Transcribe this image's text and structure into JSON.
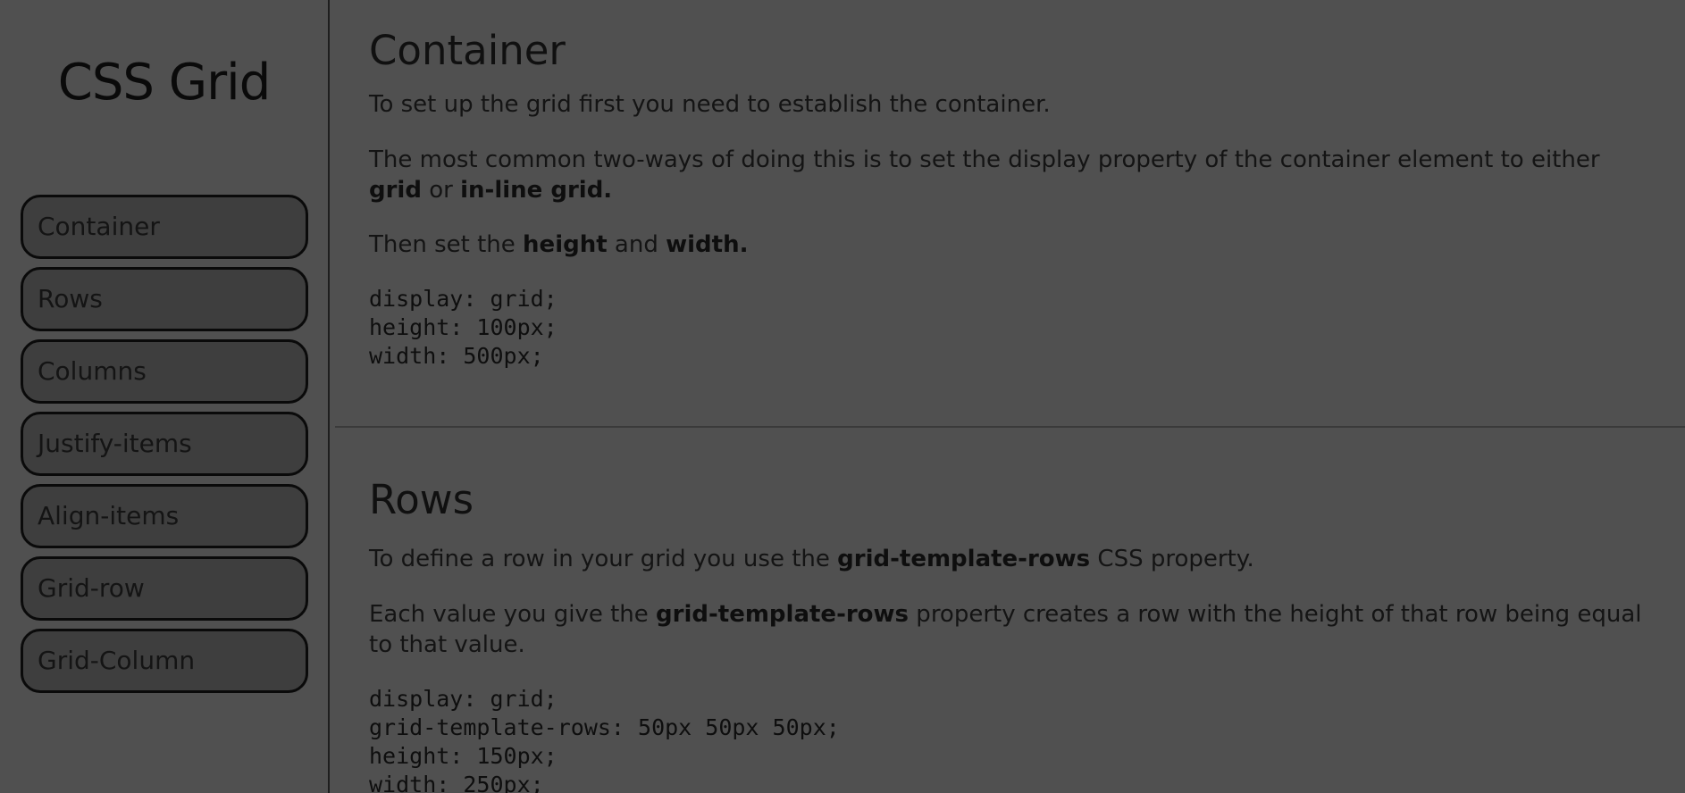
{
  "sidebar": {
    "title": "CSS Grid",
    "items": [
      {
        "label": "Container"
      },
      {
        "label": "Rows"
      },
      {
        "label": "Columns"
      },
      {
        "label": "Justify-items"
      },
      {
        "label": "Align-items"
      },
      {
        "label": "Grid-row"
      },
      {
        "label": "Grid-Column"
      }
    ]
  },
  "sections": {
    "container": {
      "title": "Container",
      "p1": "To set up the grid first you need to establish the container.",
      "p2_a": "The most common two-ways of doing this is to set the display property of the container element to either ",
      "p2_b": "grid",
      "p2_c": " or ",
      "p2_d": "in-line grid.",
      "p3_a": "Then set the ",
      "p3_b": "height",
      "p3_c": " and ",
      "p3_d": "width.",
      "code": [
        "display: grid;",
        "height: 100px;",
        "width: 500px;"
      ]
    },
    "rows": {
      "title": "Rows",
      "p1_a": "To define a row in your grid you use the ",
      "p1_b": "grid-template-rows",
      "p1_c": " CSS property.",
      "p2_a": "Each value you give the ",
      "p2_b": "grid-template-rows",
      "p2_c": " property creates a row with the height of that row being equal to that value.",
      "code": [
        "display: grid;",
        "grid-template-rows: 50px 50px 50px;",
        "height: 150px;",
        "width: 250px;"
      ]
    }
  }
}
